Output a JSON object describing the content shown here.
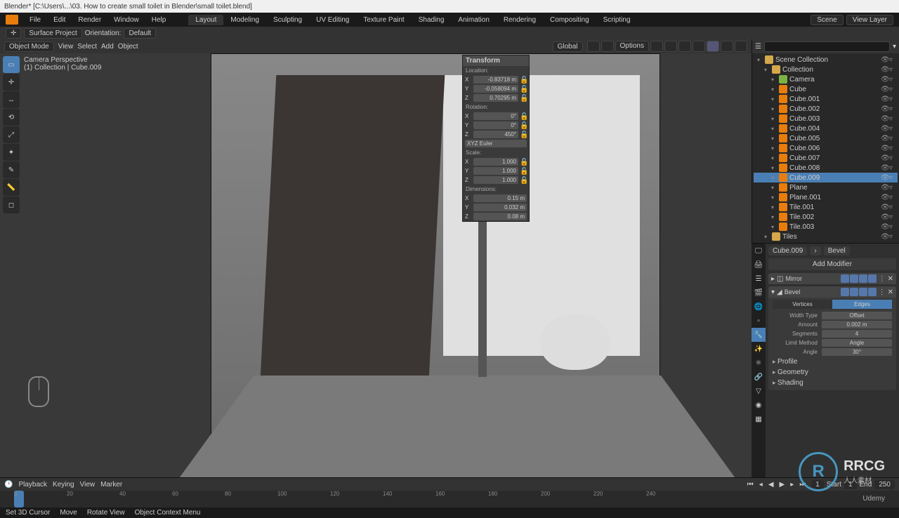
{
  "title": "Blender* [C:\\Users\\...\\03. How to create small toilet in Blender\\small toilet.blend]",
  "menus": [
    "File",
    "Edit",
    "Render",
    "Window",
    "Help"
  ],
  "workspaces": [
    "Layout",
    "Modeling",
    "Sculpting",
    "UV Editing",
    "Texture Paint",
    "Shading",
    "Animation",
    "Rendering",
    "Compositing",
    "Scripting"
  ],
  "active_workspace": "Layout",
  "scene": "Scene",
  "viewlayer": "View Layer",
  "secondbar": {
    "surface_project": "Surface Project",
    "orientation": "Orientation:",
    "default": "Default"
  },
  "viewport_header": {
    "mode": "Object Mode",
    "menus": [
      "View",
      "Select",
      "Add",
      "Object"
    ],
    "global": "Global",
    "options": "Options"
  },
  "overlay": {
    "line1": "Camera Perspective",
    "line2": "(1) Collection | Cube.009"
  },
  "npanel": {
    "title": "Transform",
    "location_label": "Location:",
    "loc": {
      "x": "-0.83718 m",
      "y": "-0.058094 m",
      "z": "0.70295 m"
    },
    "rotation_label": "Rotation:",
    "rot": {
      "x": "0°",
      "y": "0°",
      "z": "450°"
    },
    "rot_mode": "XYZ Euler",
    "scale_label": "Scale:",
    "scale": {
      "x": "1.000",
      "y": "1.000",
      "z": "1.000"
    },
    "dim_label": "Dimensions:",
    "dim": {
      "x": "0.15 m",
      "y": "0.032 m",
      "z": "0.08 m"
    }
  },
  "outliner": {
    "root": "Scene Collection",
    "collection": "Collection",
    "items": [
      "Camera",
      "Cube",
      "Cube.001",
      "Cube.002",
      "Cube.003",
      "Cube.004",
      "Cube.005",
      "Cube.006",
      "Cube.007",
      "Cube.008",
      "Cube.009",
      "Plane",
      "Plane.001",
      "Tile.001",
      "Tile.002",
      "Tile.003"
    ],
    "selected": "Cube.009",
    "tiles": "Tiles"
  },
  "properties": {
    "crumb_obj": "Cube.009",
    "crumb_mod": "Bevel",
    "add_modifier": "Add Modifier",
    "mods": [
      {
        "name": "Mirror",
        "open": false
      },
      {
        "name": "Bevel",
        "open": true
      }
    ],
    "bevel": {
      "tab_vertices": "Vertices",
      "tab_edges": "Edges",
      "width_type_label": "Width Type",
      "width_type": "Offset",
      "amount_label": "Amount",
      "amount": "0.002 m",
      "segments_label": "Segments",
      "segments": "4",
      "limit_label": "Limit Method",
      "limit": "Angle",
      "angle_label": "Angle",
      "angle": "30°",
      "sections": [
        "Profile",
        "Geometry",
        "Shading"
      ]
    }
  },
  "timeline": {
    "menus": [
      "Playback",
      "Keying",
      "View",
      "Marker"
    ],
    "ticks": [
      0,
      20,
      40,
      60,
      80,
      100,
      120,
      140,
      160,
      180,
      200,
      220,
      240
    ],
    "current": "1",
    "start_label": "Start",
    "start": "1",
    "end_label": "End",
    "end": "250"
  },
  "status": {
    "items": [
      "Set 3D Cursor",
      "Move",
      "Rotate View",
      "Object Context Menu"
    ]
  },
  "watermark": {
    "brand": "RRCG",
    "sub": "人人素材"
  },
  "udemy": "Udemy"
}
